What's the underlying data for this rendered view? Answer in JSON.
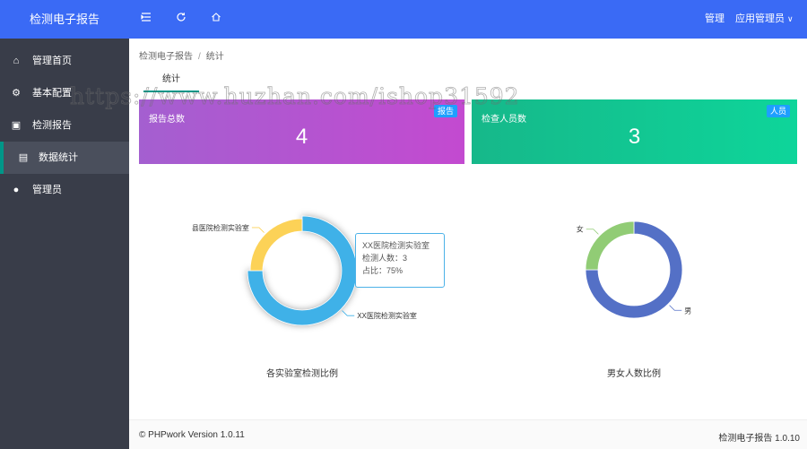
{
  "header": {
    "brand": "检测电子报告",
    "icons": [
      "menu-fold-icon",
      "refresh-icon",
      "home-icon"
    ],
    "manage_label": "管理",
    "user_label": "应用管理员",
    "user_caret": "∨"
  },
  "sidebar": {
    "items": [
      {
        "label": "管理首页",
        "icon": "home-icon",
        "glyph": "⌂"
      },
      {
        "label": "基本配置",
        "icon": "gear-icon",
        "glyph": "⚙"
      },
      {
        "label": "检测报告",
        "icon": "report-icon",
        "glyph": "▣"
      },
      {
        "label": "数据统计",
        "icon": "chart-icon",
        "glyph": "▤",
        "active": true
      },
      {
        "label": "管理员",
        "icon": "user-icon",
        "glyph": "●"
      }
    ]
  },
  "breadcrumb": {
    "parent": "检测电子报告",
    "separator": "/",
    "current": "统计"
  },
  "tab": {
    "label": "统计"
  },
  "cards": [
    {
      "title": "报告总数",
      "value": "4",
      "badge": "报告",
      "color": "#b553d0"
    },
    {
      "title": "检查人员数",
      "value": "3",
      "badge": "人员",
      "color": "#10c592"
    }
  ],
  "tooltip": {
    "name": "XX医院检测实验室",
    "count_label": "检测人数：",
    "count_value": "3",
    "share_label": "占比：",
    "share_value": "75%"
  },
  "chart_data": [
    {
      "type": "pie",
      "variant": "donut",
      "title": "各实验室检测比例",
      "categories": [
        "XX医院检测实验室",
        "县医院检测实验室"
      ],
      "values": [
        3,
        1
      ],
      "colors": [
        "#3fb1e8",
        "#fcd257"
      ]
    },
    {
      "type": "pie",
      "variant": "donut",
      "title": "男女人数比例",
      "categories": [
        "男",
        "女"
      ],
      "values": [
        3,
        1
      ],
      "colors": [
        "#5470c6",
        "#91cc75"
      ]
    }
  ],
  "watermark": "https://www.huzhan.com/ishop31592",
  "footer": {
    "left": "© PHPwork Version 1.0.11",
    "right": "检测电子报告 1.0.10"
  }
}
